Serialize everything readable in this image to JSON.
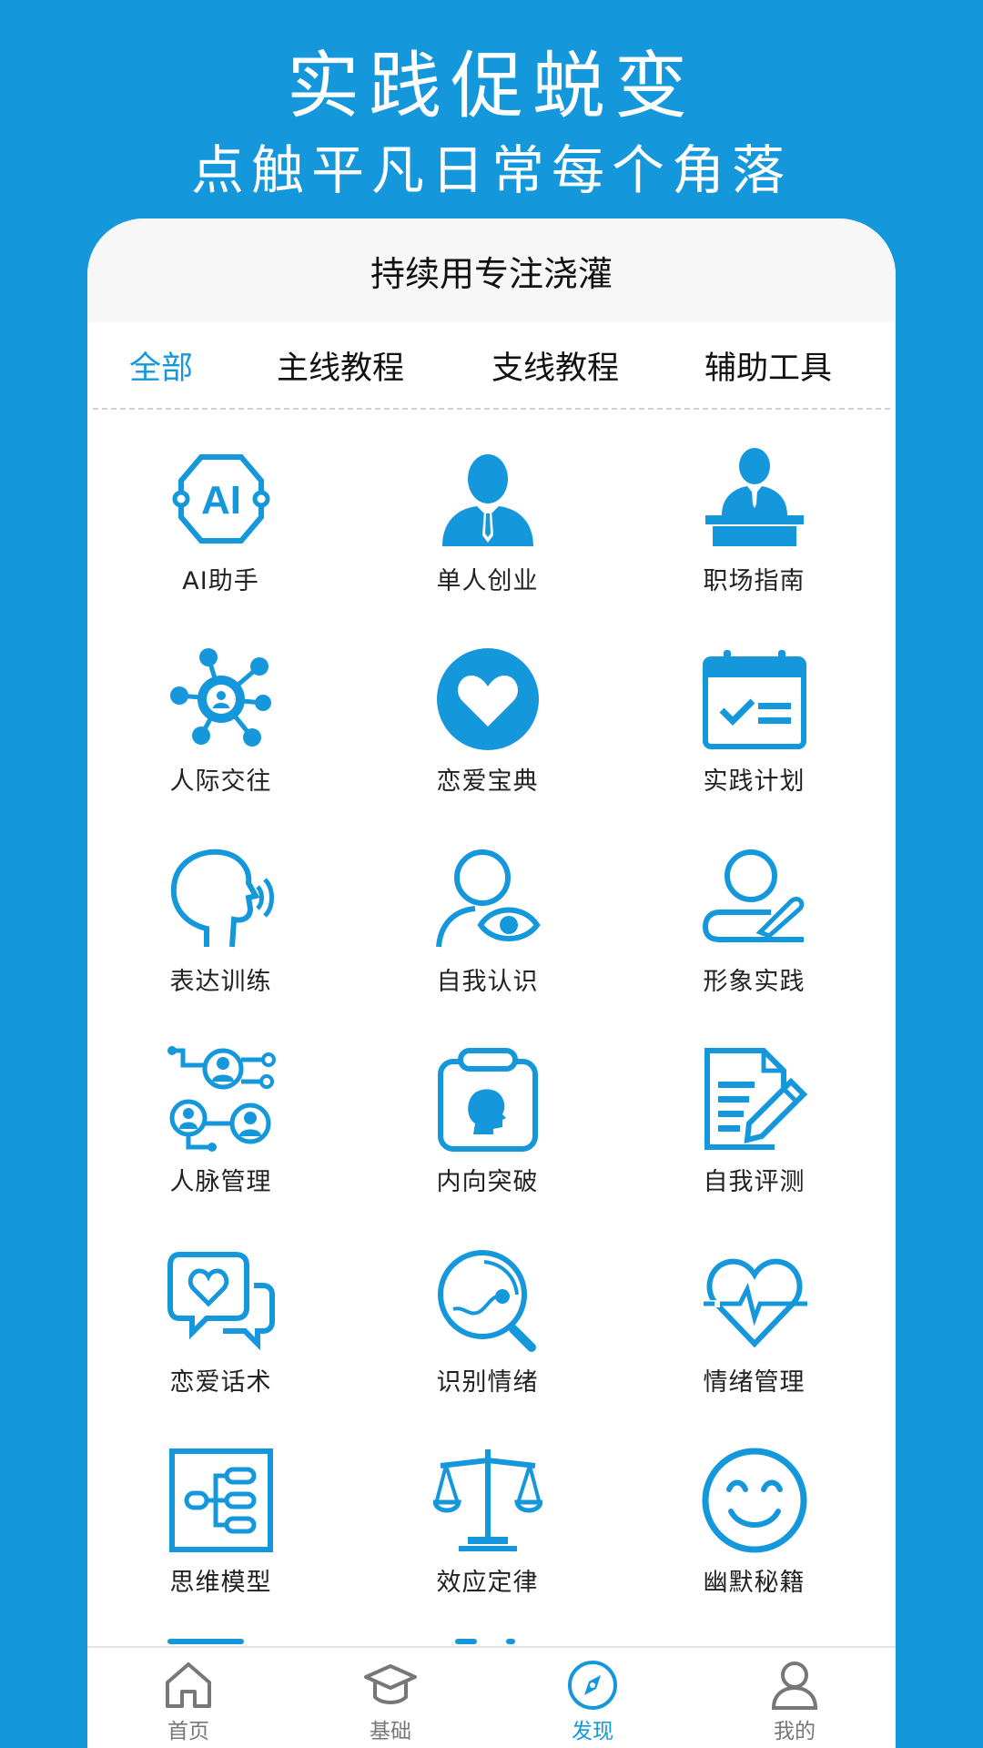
{
  "hero": {
    "title": "实践促蜕变",
    "subtitle": "点触平凡日常每个角落"
  },
  "card": {
    "header": "持续用专注浇灌"
  },
  "tabs": [
    {
      "label": "全部",
      "active": true
    },
    {
      "label": "主线教程",
      "active": false
    },
    {
      "label": "支线教程",
      "active": false
    },
    {
      "label": "辅助工具",
      "active": false
    }
  ],
  "grid": [
    {
      "label": "AI助手",
      "icon": "ai-chip-icon"
    },
    {
      "label": "单人创业",
      "icon": "businessman-icon"
    },
    {
      "label": "职场指南",
      "icon": "speaker-podium-icon"
    },
    {
      "label": "人际交往",
      "icon": "network-icon"
    },
    {
      "label": "恋爱宝典",
      "icon": "heart-circle-icon"
    },
    {
      "label": "实践计划",
      "icon": "calendar-check-icon"
    },
    {
      "label": "表达训练",
      "icon": "speaking-head-icon"
    },
    {
      "label": "自我认识",
      "icon": "person-eye-icon"
    },
    {
      "label": "形象实践",
      "icon": "person-pen-icon"
    },
    {
      "label": "人脉管理",
      "icon": "contacts-network-icon"
    },
    {
      "label": "内向突破",
      "icon": "clipboard-head-icon"
    },
    {
      "label": "自我评测",
      "icon": "document-pen-icon"
    },
    {
      "label": "恋爱话术",
      "icon": "chat-heart-icon"
    },
    {
      "label": "识别情绪",
      "icon": "magnifier-icon"
    },
    {
      "label": "情绪管理",
      "icon": "heartbeat-icon"
    },
    {
      "label": "思维模型",
      "icon": "flowchart-icon"
    },
    {
      "label": "效应定律",
      "icon": "scales-icon"
    },
    {
      "label": "幽默秘籍",
      "icon": "smiley-icon"
    }
  ],
  "bottom_nav": [
    {
      "label": "首页",
      "icon": "home-icon",
      "active": false
    },
    {
      "label": "基础",
      "icon": "graduation-cap-icon",
      "active": false
    },
    {
      "label": "发现",
      "icon": "compass-icon",
      "active": true
    },
    {
      "label": "我的",
      "icon": "user-icon",
      "active": false
    }
  ],
  "colors": {
    "accent": "#1597dc",
    "text": "#222222",
    "inactive": "#777777"
  }
}
